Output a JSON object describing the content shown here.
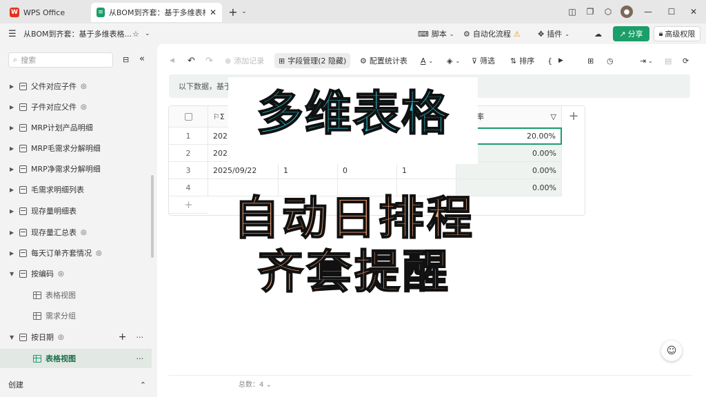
{
  "tabs": [
    {
      "label": "WPS Office"
    },
    {
      "label": "从BOM到齐套：基于多维表格构建"
    }
  ],
  "doc_title": "从BOM到齐套：基于多维表格...",
  "toolbar2": {
    "script_label": "脚本",
    "automation_label": "自动化流程",
    "plugin_label": "插件",
    "share_label": "分享",
    "permission_label": "高级权限"
  },
  "sidebar": {
    "search_placeholder": "搜索",
    "items": [
      {
        "label": "父件对应子件",
        "synced": true
      },
      {
        "label": "子件对应父件",
        "synced": true
      },
      {
        "label": "MRP计划产品明细",
        "synced": false
      },
      {
        "label": "MRP毛需求分解明细",
        "synced": false
      },
      {
        "label": "MRP净需求分解明细",
        "synced": false
      },
      {
        "label": "毛需求明细列表",
        "synced": false
      },
      {
        "label": "现存量明细表",
        "synced": false
      },
      {
        "label": "现存量汇总表",
        "synced": true
      },
      {
        "label": "每天订单齐套情况",
        "synced": true
      },
      {
        "label": "按编码",
        "synced": true
      }
    ],
    "sub_items_code": [
      {
        "label": "表格视图"
      },
      {
        "label": "需求分组"
      }
    ],
    "date_item": {
      "label": "按日期"
    },
    "date_sub": {
      "label": "表格视图"
    },
    "create_label": "创建"
  },
  "main_toolbar": {
    "add_record": "添加记录",
    "field_mgmt": "字段管理(2 隐藏)",
    "stats": "配置统计表",
    "filter": "筛选",
    "sort": "排序"
  },
  "notice": "以下数据，基于",
  "table": {
    "last_header": "齐套率",
    "rows": [
      {
        "num": "1",
        "date": "2025",
        "a": "",
        "b": "",
        "c": "",
        "rate": "20.00%"
      },
      {
        "num": "2",
        "date": "2025",
        "a": "",
        "b": "",
        "c": "",
        "rate": "0.00%"
      },
      {
        "num": "3",
        "date": "2025/09/22",
        "a": "1",
        "b": "0",
        "c": "1",
        "rate": "0.00%"
      },
      {
        "num": "4",
        "date": "",
        "a": "",
        "b": "",
        "c": "",
        "rate": "0.00%"
      }
    ],
    "add_row": "+",
    "add_col": "+"
  },
  "footer": {
    "total": "总数：4"
  },
  "overlay": {
    "title": "多维表格",
    "line1": "自动日排程",
    "line2": "齐套提醒"
  },
  "colors": {
    "accent": "#1b9e6a",
    "overlay_title": "#22c3d8",
    "overlay_text": "#f4a477"
  }
}
